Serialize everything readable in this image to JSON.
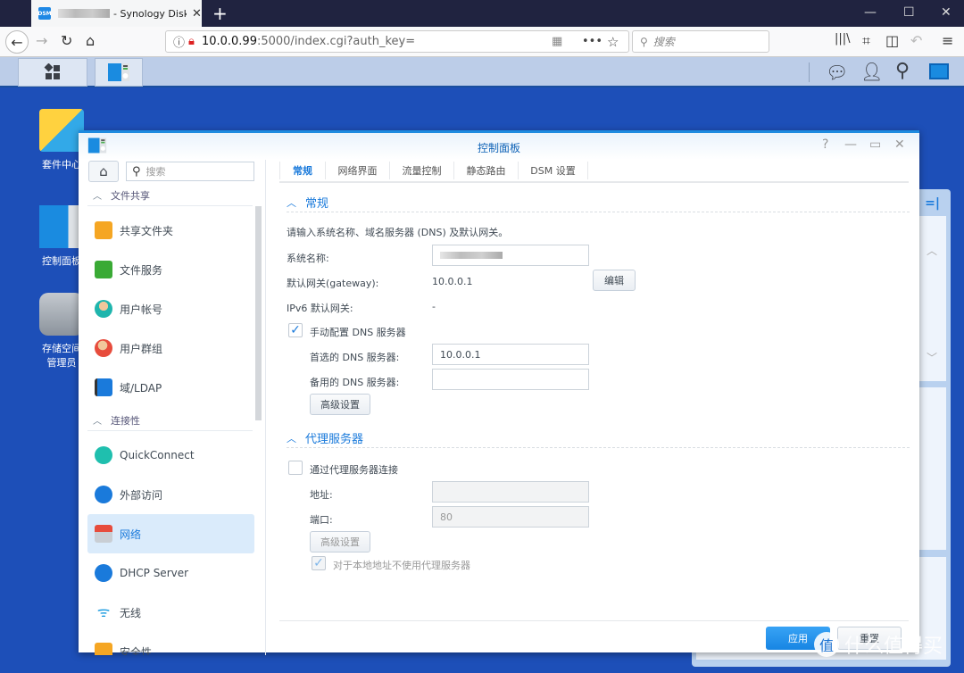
{
  "browser": {
    "tab_title": "- Synology DiskS",
    "tab_favicon": "DSM",
    "url_host": "10.0.0.99",
    "url_rest": ":5000/index.cgi?auth_key=",
    "search_placeholder": "搜索",
    "new_tab": "+",
    "window_controls": {
      "minimize": "—",
      "maximize": "☐",
      "close": "✕"
    }
  },
  "dsm_taskbar": {
    "right_icons": [
      "chat-icon",
      "user-icon",
      "search-icon",
      "widget-icon"
    ]
  },
  "desktop": {
    "icons": [
      {
        "label": "套件中心"
      },
      {
        "label": "控制面板"
      },
      {
        "label": "存储空间管理员"
      }
    ]
  },
  "window": {
    "title": "控制面板",
    "controls": {
      "help": "?",
      "minimize": "—",
      "maximize": "▭",
      "close": "✕"
    },
    "sidebar": {
      "search_placeholder": "搜索",
      "sections": [
        {
          "label": "文件共享",
          "items": [
            {
              "label": "共享文件夹",
              "icon": "shared-folder-icon",
              "color": "#f5a623"
            },
            {
              "label": "文件服务",
              "icon": "file-services-icon",
              "color": "#3aaa35"
            },
            {
              "label": "用户帐号",
              "icon": "user-icon",
              "color": "#1fb5ad"
            },
            {
              "label": "用户群组",
              "icon": "group-icon",
              "color": "#e74c3c"
            },
            {
              "label": "域/LDAP",
              "icon": "ldap-icon",
              "color": "#1a7adb"
            }
          ]
        },
        {
          "label": "连接性",
          "items": [
            {
              "label": "QuickConnect",
              "icon": "quickconnect-icon",
              "color": "#1fbfae"
            },
            {
              "label": "外部访问",
              "icon": "globe-icon",
              "color": "#1a7adb"
            },
            {
              "label": "网络",
              "icon": "network-icon",
              "color": "#e74c3c",
              "active": true
            },
            {
              "label": "DHCP Server",
              "icon": "dhcp-icon",
              "color": "#1a7adb"
            },
            {
              "label": "无线",
              "icon": "wifi-icon",
              "color": "#1a9be0"
            },
            {
              "label": "安全性",
              "icon": "security-icon",
              "color": "#f5a623"
            }
          ]
        }
      ]
    },
    "tabs": [
      {
        "label": "常规",
        "active": true
      },
      {
        "label": "网络界面"
      },
      {
        "label": "流量控制"
      },
      {
        "label": "静态路由"
      },
      {
        "label": "DSM 设置"
      }
    ],
    "general": {
      "header": "常规",
      "description": "请输入系统名称、域名服务器 (DNS) 及默认网关。",
      "system_name_label": "系统名称:",
      "system_name_value": "",
      "gateway_label": "默认网关(gateway):",
      "gateway_value": "10.0.0.1",
      "edit_button": "编辑",
      "ipv6_gateway_label": "IPv6 默认网关:",
      "ipv6_gateway_value": "-",
      "manual_dns_label": "手动配置 DNS 服务器",
      "manual_dns_checked": true,
      "preferred_dns_label": "首选的 DNS 服务器:",
      "preferred_dns_value": "10.0.0.1",
      "alternate_dns_label": "备用的 DNS 服务器:",
      "alternate_dns_value": "",
      "advanced_button": "高级设置"
    },
    "proxy": {
      "header": "代理服务器",
      "connect_via_proxy_label": "通过代理服务器连接",
      "connect_via_proxy_checked": false,
      "address_label": "地址:",
      "address_value": "",
      "port_label": "端口:",
      "port_value": "80",
      "advanced_button": "高级设置",
      "bypass_local_label": "对于本地地址不使用代理服务器",
      "bypass_local_checked": true
    },
    "footer": {
      "apply": "应用",
      "reset": "重置"
    }
  },
  "watermark": {
    "badge": "值",
    "text": "什么值得买"
  }
}
